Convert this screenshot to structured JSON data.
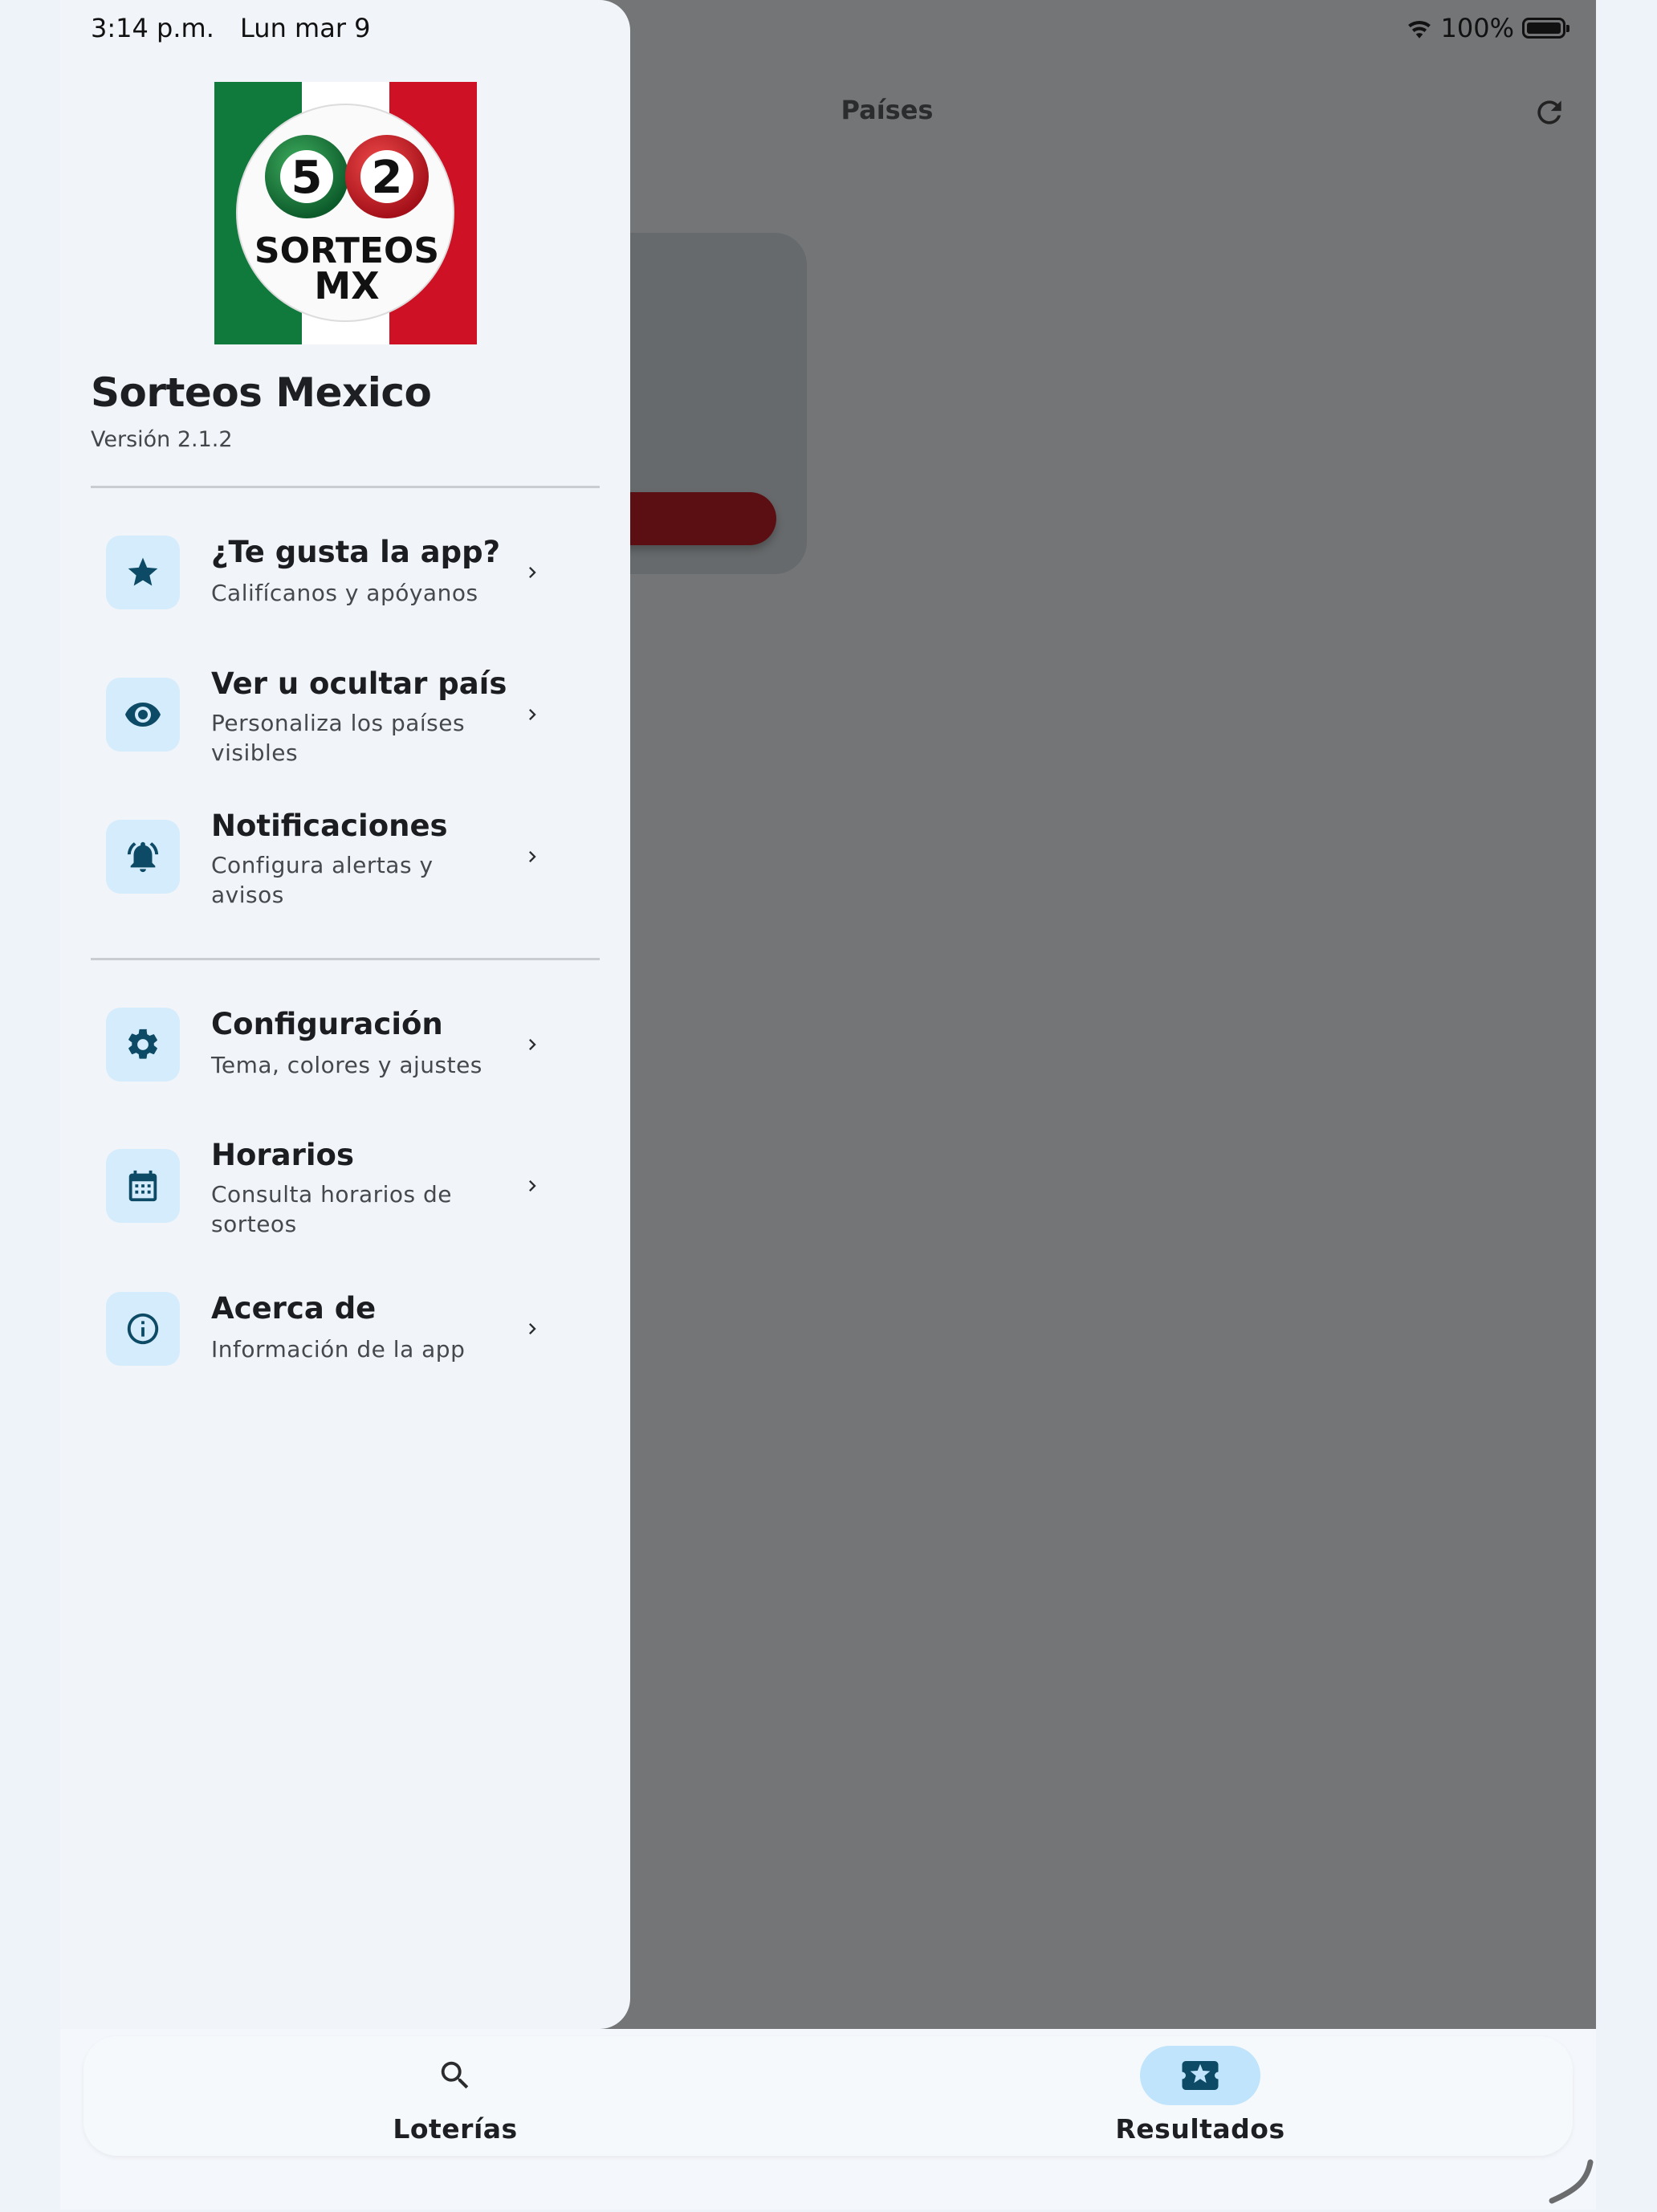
{
  "status_bar": {
    "time": "3:14 p.m.",
    "date": "Lun mar 9",
    "battery": "100%",
    "battery_level": 1.0
  },
  "background_app": {
    "title": "Países"
  },
  "drawer": {
    "logo": {
      "ball_left": "5",
      "ball_right": "2",
      "line1": "SORTEOS",
      "line2": "MX"
    },
    "app_name": "Sorteos Mexico",
    "version": "Versión 2.1.2",
    "items": [
      {
        "title": "¿Te gusta la app?",
        "subtitle": "Califícanos y apóyanos",
        "icon": "star-icon"
      },
      {
        "title": "Ver u ocultar país",
        "subtitle": "Personaliza los países visibles",
        "icon": "eye-icon"
      },
      {
        "title": "Notificaciones",
        "subtitle": "Configura alertas y avisos",
        "icon": "bell-icon"
      },
      {
        "title": "Configuración",
        "subtitle": "Tema, colores y ajustes",
        "icon": "gear-icon"
      },
      {
        "title": "Horarios",
        "subtitle": "Consulta horarios de sorteos",
        "icon": "calendar-icon"
      },
      {
        "title": "Acerca de",
        "subtitle": "Información de la app",
        "icon": "info-icon"
      }
    ]
  },
  "bottom_nav": {
    "items": [
      {
        "label": "Loterías",
        "icon": "search-icon",
        "active": false
      },
      {
        "label": "Resultados",
        "icon": "ticket-star-icon",
        "active": true
      }
    ]
  },
  "colors": {
    "accent": "#0c4a66",
    "icon_bg": "#d4ecfb",
    "nav_active_bg": "#bfe4fb",
    "scrim": "#737577"
  }
}
